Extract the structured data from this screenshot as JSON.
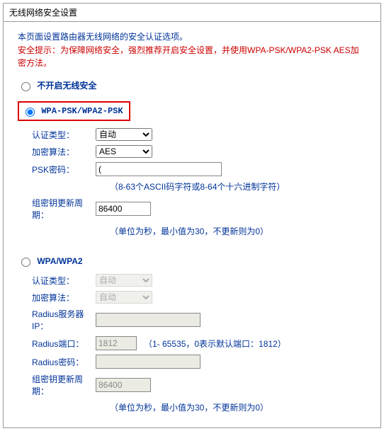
{
  "title": "无线网络安全设置",
  "intro": "本页面设置路由器无线网络的安全认证选项。",
  "warning": "安全提示：为保障网络安全，强烈推荐开启安全设置，并使用WPA-PSK/WPA2-PSK AES加密方法。",
  "option_disable": "不开启无线安全",
  "option_psk": "WPA-PSK/WPA2-PSK",
  "option_wpa": "WPA/WPA2",
  "labels": {
    "auth_type": "认证类型：",
    "enc_algo": "加密算法：",
    "psk_pw": "PSK密码：",
    "group_rekey": "组密钥更新周期：",
    "radius_ip": "Radius服务器IP：",
    "radius_port": "Radius端口：",
    "radius_pw": "Radius密码："
  },
  "selects": {
    "auto": "自动",
    "aes": "AES"
  },
  "values": {
    "psk_pw": "(",
    "group_rekey": "86400",
    "radius_port": "1812",
    "radius_rekey": "86400"
  },
  "hints": {
    "psk": "（8-63个ASCII码字符或8-64个十六进制字符）",
    "group": "（单位为秒，最小值为30，不更新则为0）",
    "radius_port": "（1- 65535，0表示默认端口：1812）"
  }
}
